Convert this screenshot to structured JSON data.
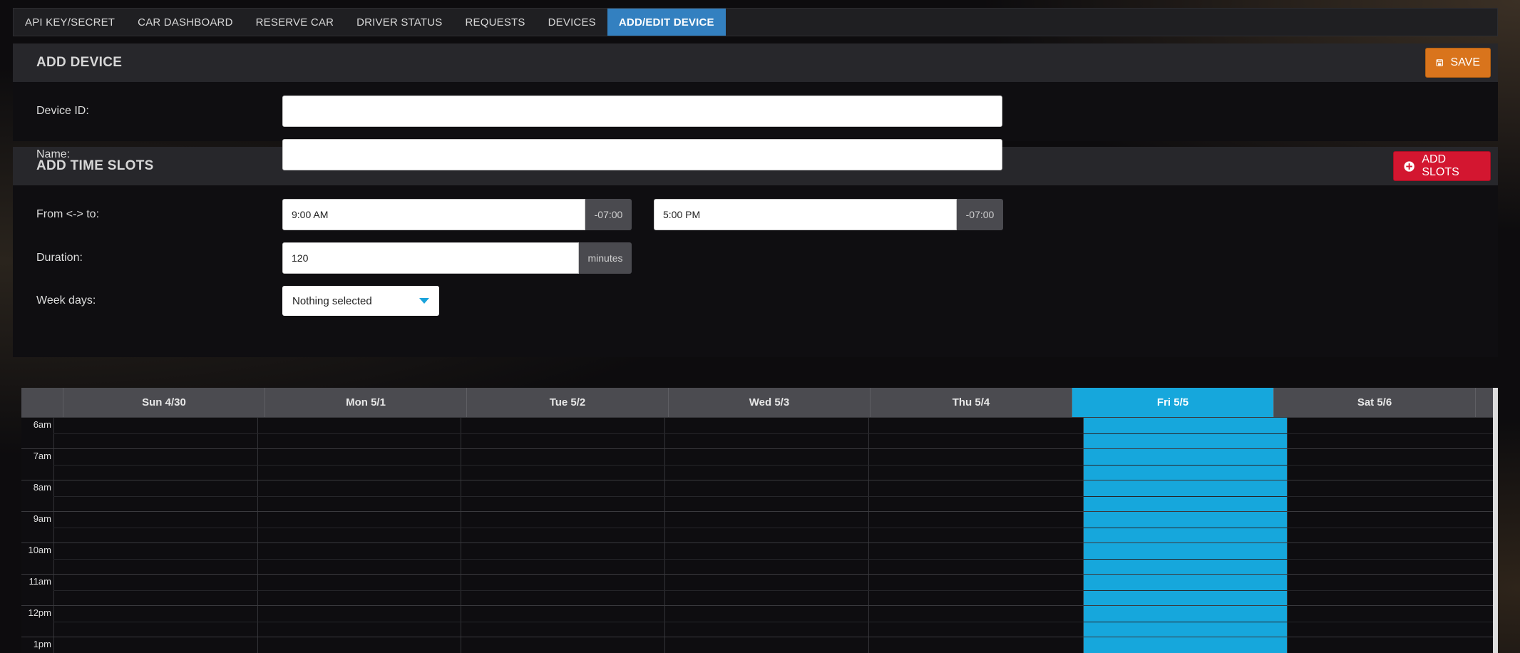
{
  "nav": {
    "tabs": [
      {
        "label": "API KEY/SECRET"
      },
      {
        "label": "CAR DASHBOARD"
      },
      {
        "label": "RESERVE CAR"
      },
      {
        "label": "DRIVER STATUS"
      },
      {
        "label": "REQUESTS"
      },
      {
        "label": "DEVICES"
      },
      {
        "label": "ADD/EDIT DEVICE",
        "active": true
      }
    ]
  },
  "device": {
    "title": "ADD DEVICE",
    "save_label": "SAVE",
    "fields": {
      "device_id_label": "Device ID:",
      "device_id_value": "",
      "name_label": "Name:",
      "name_value": ""
    }
  },
  "slots": {
    "title": "ADD TIME SLOTS",
    "add_label": "ADD SLOTS",
    "from_to_label": "From <-> to:",
    "from_value": "9:00 AM",
    "from_tz": "-07:00",
    "to_value": "5:00 PM",
    "to_tz": "-07:00",
    "duration_label": "Duration:",
    "duration_value": "120",
    "duration_unit": "minutes",
    "weekdays_label": "Week days:",
    "weekdays_value": "Nothing selected"
  },
  "calendar": {
    "days": [
      {
        "label": "Sun 4/30"
      },
      {
        "label": "Mon 5/1"
      },
      {
        "label": "Tue 5/2"
      },
      {
        "label": "Wed 5/3"
      },
      {
        "label": "Thu 5/4"
      },
      {
        "label": "Fri 5/5",
        "today": true
      },
      {
        "label": "Sat 5/6"
      }
    ],
    "hours": [
      "6am",
      "7am",
      "8am",
      "9am",
      "10am",
      "11am",
      "12pm",
      "1pm"
    ],
    "today_color": "#16a7dc"
  },
  "colors": {
    "accent_tab": "#3380c0",
    "save": "#d9741c",
    "add_slots": "#d31630"
  }
}
